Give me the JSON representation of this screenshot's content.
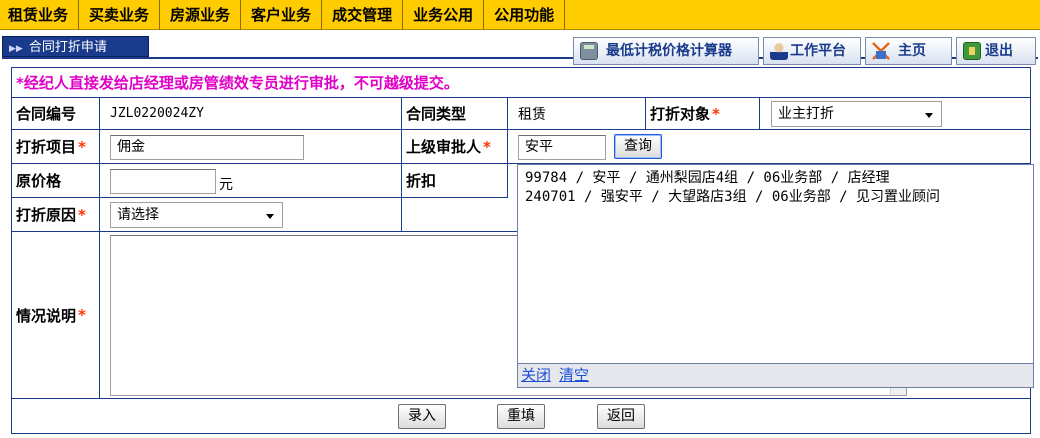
{
  "menu": [
    "租赁业务",
    "买卖业务",
    "房源业务",
    "客户业务",
    "成交管理",
    "业务公用",
    "公用功能"
  ],
  "page_title": "合同打折申请",
  "toolbar": {
    "calculator": "最低计税价格计算器",
    "workbench": "工作平台",
    "home": "主页",
    "logout": "退出"
  },
  "notice": "*经纪人直接发给店经理或房管绩效专员进行审批，不可越级提交。",
  "form": {
    "contract_no_label": "合同编号",
    "contract_no_value": "JZL0220024ZY",
    "contract_type_label": "合同类型",
    "contract_type_value": "租赁",
    "discount_target_label": "打折对象",
    "discount_target_value": "业主打折",
    "discount_item_label": "打折项目",
    "discount_item_value": "佣金",
    "approver_label": "上级审批人",
    "approver_value": "安平",
    "query_button": "查询",
    "original_price_label": "原价格",
    "original_price_value": "",
    "yuan_unit": "元",
    "discount_label": "折扣",
    "reason_label": "打折原因",
    "reason_value": "请选择",
    "description_label": "情况说明",
    "required_mark": "*"
  },
  "popup": {
    "results": [
      "99784 / 安平 / 通州梨园店4组 / 06业务部 / 店经理",
      "240701 / 强安平 / 大望路店3组 / 06业务部 / 见习置业顾问"
    ],
    "close": "关闭",
    "clear": "清空"
  },
  "actions": {
    "submit": "录入",
    "reset": "重填",
    "back": "返回"
  }
}
